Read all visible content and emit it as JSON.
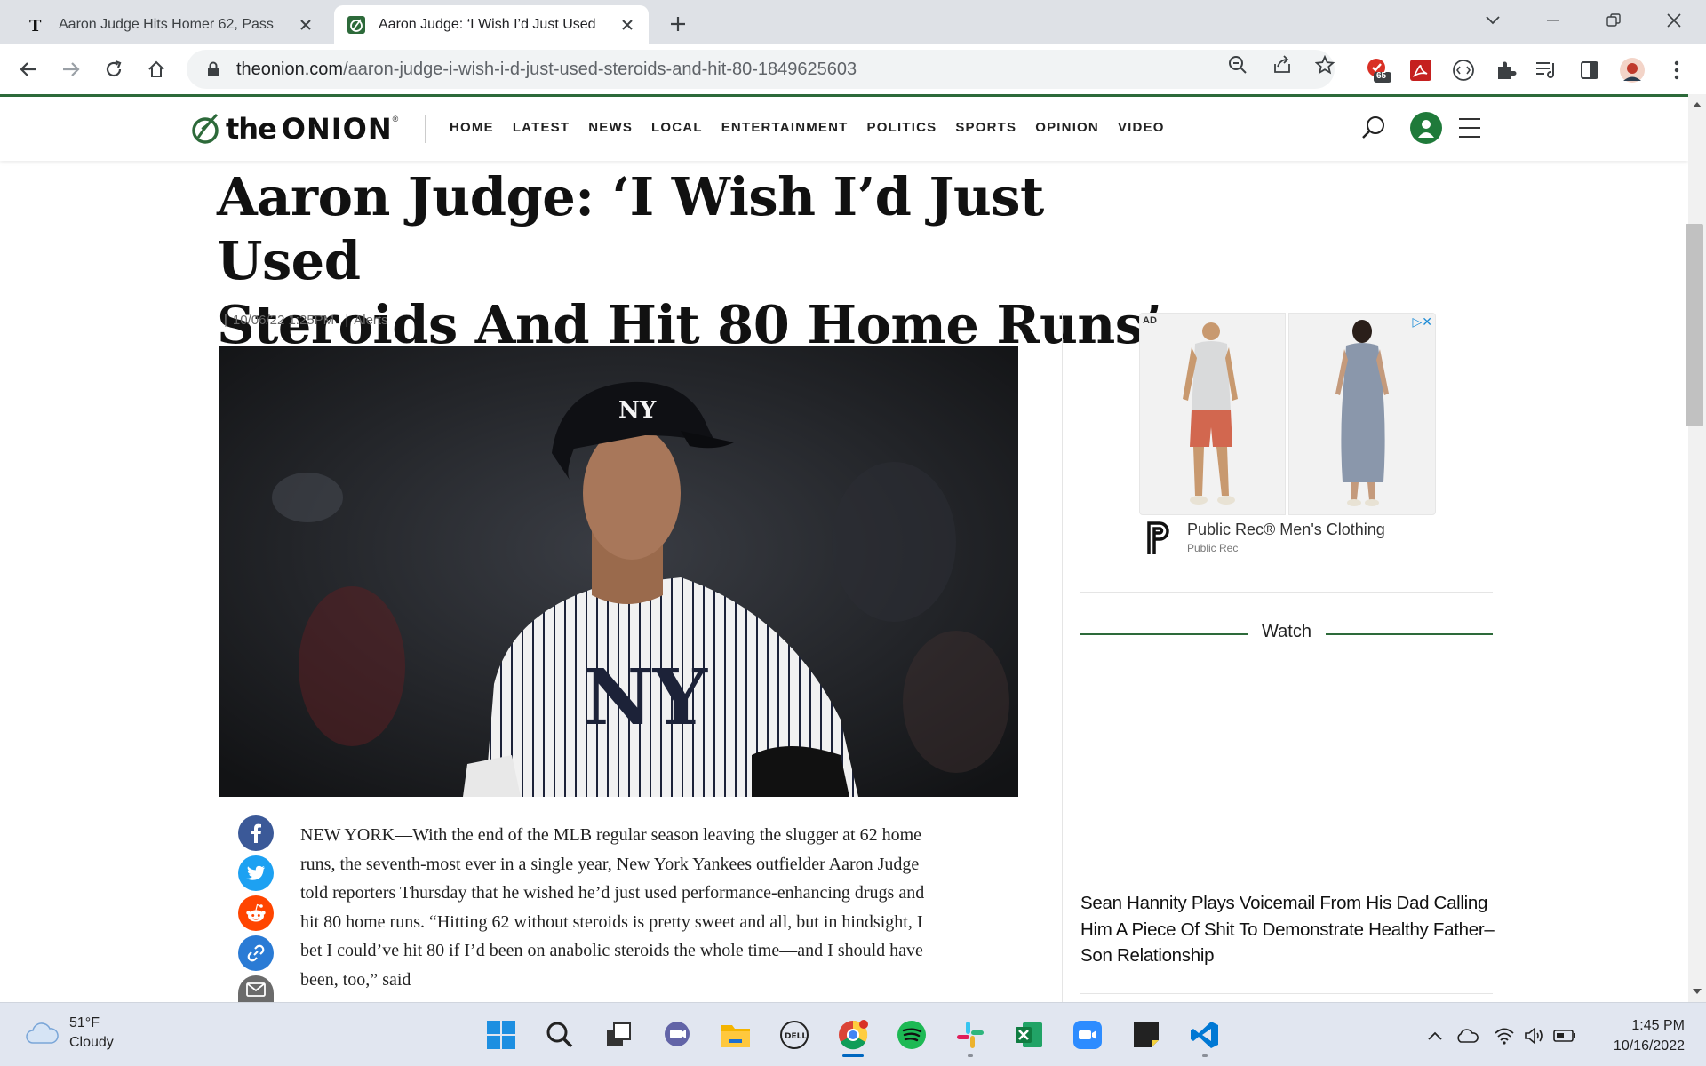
{
  "browser": {
    "tabs": [
      {
        "title": "Aaron Judge Hits Homer 62, Pass",
        "active": false
      },
      {
        "title": "Aaron Judge: ‘I Wish I’d Just Used",
        "active": true
      }
    ],
    "url_host": "theonion.com",
    "url_path": "/aaron-judge-i-wish-i-d-just-used-steroids-and-hit-80-1849625603",
    "extension_badge": "65"
  },
  "site": {
    "logo_the": "the",
    "logo_onion": "ONION",
    "logo_reg": "®",
    "nav": [
      "HOME",
      "LATEST",
      "NEWS",
      "LOCAL",
      "ENTERTAINMENT",
      "POLITICS",
      "SPORTS",
      "OPINION",
      "VIDEO"
    ]
  },
  "article": {
    "headline_line1": "Aaron Judge: ‘I Wish I’d Just Used",
    "headline_line2": "Steroids And Hit 80 Home Runs’",
    "meta_sep": "|",
    "timestamp": "10/06/22 1:25PM",
    "section": "Alerts",
    "body": "NEW YORK—With the end of the MLB regular season leaving the slugger at 62 home runs, the seventh-most ever in a single year, New York Yankees outfielder Aaron Judge told reporters Thursday that he wished he’d just used performance-enhancing drugs and hit 80 home runs. “Hitting 62 without steroids is pretty sweet and all, but in hindsight, I bet I could’ve hit 80 if I’d been on anabolic steroids the whole time—and I should have been, too,” said"
  },
  "sidebar": {
    "ad_label": "AD",
    "ad_title": "Public Rec® Men's Clothing",
    "ad_sponsor": "Public Rec",
    "watch_label": "Watch",
    "video_headline": "Sean Hannity Plays Voicemail From His Dad Calling Him A Piece Of Shit To Demonstrate Healthy Father–Son Relationship"
  },
  "taskbar": {
    "temperature": "51°F",
    "condition": "Cloudy",
    "time": "1:45 PM",
    "date": "10/16/2022"
  },
  "colors": {
    "onion_green": "#2d6a3a",
    "facebook": "#3b5998",
    "twitter": "#1da1f2",
    "reddit": "#ff4500",
    "link": "#2a7bd5"
  }
}
